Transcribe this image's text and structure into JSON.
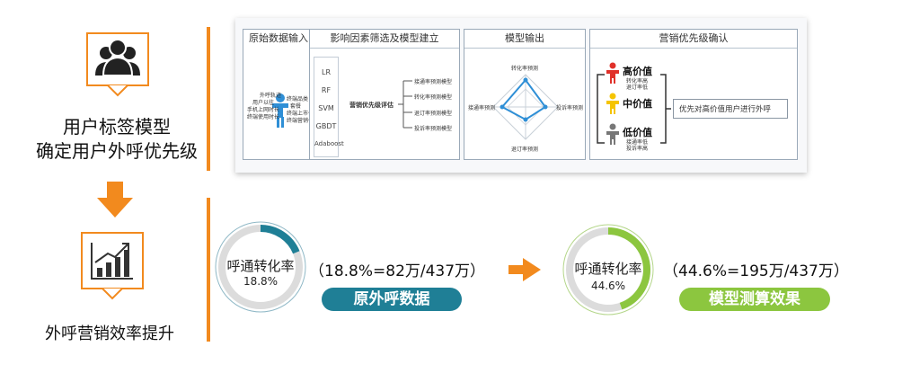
{
  "left": {
    "top_label_line1": "用户标签模型",
    "top_label_line2": "确定用户外呼优先级",
    "bottom_label": "外呼营销效率提升"
  },
  "colors": {
    "orange": "#f28a1e",
    "teal": "#1f7f96",
    "green": "#8cc63f",
    "red": "#e0312a",
    "yellow": "#f5c400",
    "gray": "#777777",
    "blue": "#2f8fd6"
  },
  "panels": {
    "raw": {
      "title": "原始数据输入",
      "left_tags": [
        "外呼轨迹",
        "用户以往",
        "手机上网时长",
        "终端使用时长"
      ],
      "right_tags": [
        "终端品类",
        "套餐",
        "终端上市价格",
        "终端营销价格"
      ]
    },
    "model": {
      "title": "影响因素筛选及模型建立",
      "algorithms": [
        "LR",
        "RF",
        "SVM",
        "GBDT",
        "Adaboost"
      ],
      "center": "营销优先级评估",
      "outputs": [
        "接通率预测模型",
        "转化率预测模型",
        "退订率预测模型",
        "投诉率预测模型"
      ]
    },
    "output": {
      "title": "模型输出",
      "top": "转化率预测",
      "left": "接通率预测",
      "right": "投诉率预测",
      "bottom": "退订率预测"
    },
    "priority": {
      "title": "营销优先级确认",
      "levels": [
        {
          "name": "高价值",
          "sub1": "转化率高",
          "sub2": "退订率低"
        },
        {
          "name": "中价值",
          "sub1": "",
          "sub2": ""
        },
        {
          "name": "低价值",
          "sub1": "接通率低",
          "sub2": "投诉率高"
        }
      ],
      "action": "优先对高价值用户进行外呼"
    }
  },
  "results": {
    "before": {
      "gauge_title": "呼通转化率",
      "gauge_value": "18.8%",
      "fraction": 0.188,
      "formula": "（18.8%=82万/437万）",
      "pill": "原外呼数据"
    },
    "after": {
      "gauge_title": "呼通转化率",
      "gauge_value": "44.6%",
      "fraction": 0.446,
      "formula": "（44.6%=195万/437万）",
      "pill": "模型测算效果"
    }
  }
}
